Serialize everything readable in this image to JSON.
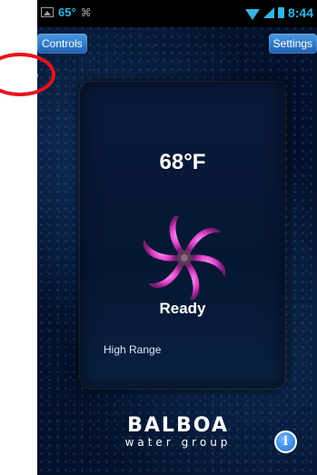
{
  "status_bar": {
    "temperature": "65°",
    "time": "8:44",
    "icons": [
      "image-notification-icon",
      "gesture-icon",
      "wifi-icon",
      "signal-icon",
      "battery-icon"
    ]
  },
  "header": {
    "controls_label": "Controls",
    "settings_label": "Settings"
  },
  "cloud": {
    "icon": "cloud-icon",
    "highlight_color": "#e8121b"
  },
  "panel": {
    "temperature": "68°F",
    "status": "Ready",
    "range": "High Range",
    "heater_icon": "heater-swirl-icon"
  },
  "brand": {
    "name": "BALBOA",
    "subtitle": "water group"
  },
  "info": {
    "icon": "info-icon",
    "label": "i"
  },
  "colors": {
    "accent": "#33b5e5",
    "button": "#2f7fd0",
    "swirl": "#e040c8"
  }
}
